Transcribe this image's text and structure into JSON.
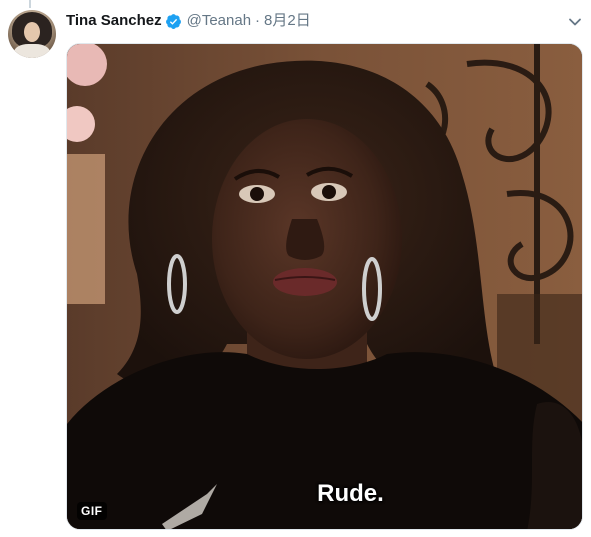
{
  "tweet": {
    "author": {
      "display_name": "Tina Sanchez",
      "handle": "@Teanah",
      "verified": true,
      "avatar_icon": "user-avatar"
    },
    "separator": "·",
    "date": "8月2日",
    "menu_icon": "chevron-down-icon",
    "media": {
      "type": "gif",
      "badge": "GIF",
      "caption": "Rude."
    }
  },
  "colors": {
    "name": "#14171a",
    "secondary": "#657786",
    "verified": "#1da1f2",
    "border": "#e1e8ed",
    "thread_line": "#ccd6dd"
  }
}
